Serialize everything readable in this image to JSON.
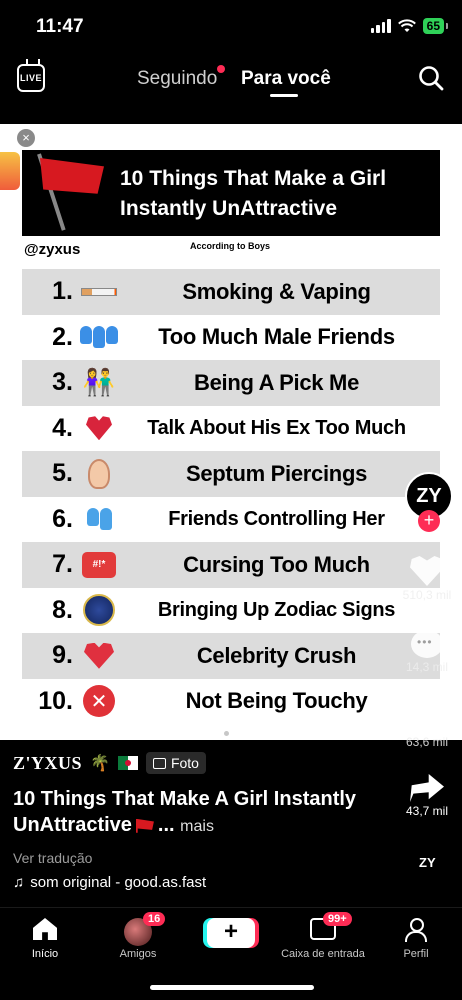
{
  "status_bar": {
    "time": "11:47",
    "battery": "65"
  },
  "top_nav": {
    "live_label": "LIVE",
    "tab_following": "Seguindo",
    "tab_for_you": "Para você"
  },
  "post_image": {
    "banner_title": "10 Things That Make a Girl Instantly UnAttractive",
    "handle": "@zyxus",
    "subtitle": "According to Boys",
    "items": [
      {
        "num": "1.",
        "icon": "cigarette-icon",
        "label": "Smoking & Vaping"
      },
      {
        "num": "2.",
        "icon": "people-icon",
        "label": "Too Much Male Friends"
      },
      {
        "num": "3.",
        "icon": "couple-icon",
        "label": "Being A Pick Me"
      },
      {
        "num": "4.",
        "icon": "broken-heart-icon",
        "label": "Talk About His Ex Too Much"
      },
      {
        "num": "5.",
        "icon": "nose-icon",
        "label": "Septum Piercings"
      },
      {
        "num": "6.",
        "icon": "people-icon",
        "label": "Friends Controlling Her"
      },
      {
        "num": "7.",
        "icon": "cursing-icon",
        "label": "Cursing Too Much"
      },
      {
        "num": "8.",
        "icon": "zodiac-icon",
        "label": "Bringing Up Zodiac Signs"
      },
      {
        "num": "9.",
        "icon": "heart-arrow-icon",
        "label": "Celebrity Crush"
      },
      {
        "num": "10.",
        "icon": "x-icon",
        "label": "Not Being Touchy"
      }
    ]
  },
  "actions": {
    "likes": "510,3 mil",
    "comments": "14,3 mil",
    "saves": "63,6 mil",
    "shares": "43,7 mil"
  },
  "caption": {
    "author": "Z'YXUS",
    "photo_badge": "Foto",
    "title": "10 Things That Make A Girl Instantly UnAttractive",
    "ellipsis": "...",
    "more": "mais",
    "translate": "Ver tradução",
    "sound": "som original - good.as.fast"
  },
  "bottom_nav": {
    "home": "Início",
    "friends": "Amigos",
    "friends_badge": "16",
    "inbox": "Caixa de entrada",
    "inbox_badge": "99+",
    "profile": "Perfil",
    "create": "+"
  },
  "colors": {
    "accent": "#fe2c55",
    "secondary_accent": "#25f4ee",
    "battery": "#2fd158"
  }
}
